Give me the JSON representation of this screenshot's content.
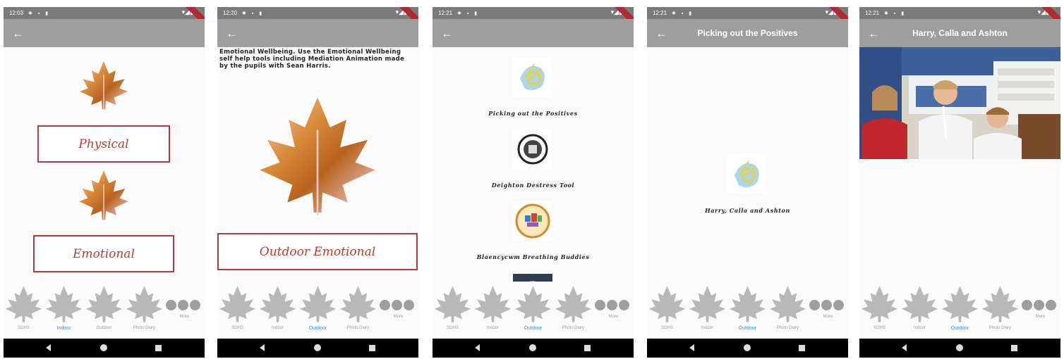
{
  "screens": [
    {
      "time": "12:03",
      "title": "",
      "buttons": [
        "Physical",
        "Emotional"
      ],
      "active_tab": "Indoor"
    },
    {
      "time": "12:20",
      "title": "",
      "description": "Emotional Wellbeing. Use the Emotional Wellbeing self help tools including Mediation Animation made by the pupils with Sean Harris.",
      "buttons": [
        "Outdoor Emotional"
      ],
      "active_tab": "Outdoor"
    },
    {
      "time": "12:21",
      "title": "",
      "items": [
        "Picking out the Positives",
        "Deighton Destress Tool",
        "Blaencycwm Breathing Buddies"
      ],
      "active_tab": "Outdoor"
    },
    {
      "time": "12:21",
      "title": "Picking out the Positives",
      "items": [
        "Harry, Calla and Ashton"
      ],
      "active_tab": "Outdoor"
    },
    {
      "time": "12:21",
      "title": "Harry, Calla and Ashton",
      "active_tab": "Outdoor"
    }
  ],
  "tabs": [
    "SGHS",
    "Indoor",
    "Outdoor",
    "Photo Diary"
  ],
  "more_label": "More",
  "icons": {
    "back": "back-arrow-icon",
    "tab": "maple-leaf-icon",
    "more": "three-dots-icon",
    "nav": [
      "triangle-back-icon",
      "circle-home-icon",
      "square-recents-icon"
    ]
  },
  "colors": {
    "app_bar": "#9e9e9e",
    "status_bar": "#7a7a7a",
    "accent_tab": "#2196f3",
    "button_border": "#b33a3a",
    "button_text": "#c0392b",
    "nav_bar": "#000000"
  }
}
